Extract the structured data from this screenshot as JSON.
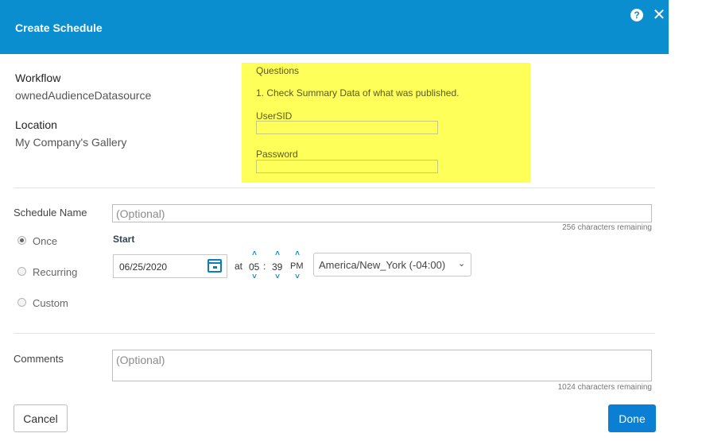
{
  "header": {
    "title": "Create Schedule",
    "help_glyph": "?",
    "close_glyph": "✕",
    "background_color": "#0a8ecf"
  },
  "info": {
    "workflow_label": "Workflow",
    "workflow_value": "ownedAudienceDatasource",
    "location_label": "Location",
    "location_value": "My Company's Gallery"
  },
  "questions": {
    "title": "Questions",
    "instruction": "1. Check Summary Data of what was published.",
    "usersid_label": "UserSID",
    "usersid_value": "",
    "password_label": "Password",
    "password_value": "",
    "highlight_color": "#ffff5a"
  },
  "schedule": {
    "name_label": "Schedule Name",
    "name_placeholder": "(Optional)",
    "name_value": "",
    "name_hint": "256 characters remaining",
    "frequency_options": [
      {
        "label": "Once",
        "selected": true
      },
      {
        "label": "Recurring",
        "selected": false
      },
      {
        "label": "Custom",
        "selected": false
      }
    ],
    "start_label": "Start",
    "date_value": "06/25/2020",
    "at_label": "at",
    "hour": "05",
    "time_separator": ":",
    "minute": "39",
    "meridiem": "PM",
    "up_glyph": "˄",
    "down_glyph": "˅",
    "timezone": "America/New_York (-04:00)",
    "timezone_chevron": "⌄"
  },
  "comments": {
    "label": "Comments",
    "placeholder": "(Optional)",
    "value": "",
    "hint": "1024 characters remaining"
  },
  "footer": {
    "cancel_label": "Cancel",
    "done_label": "Done",
    "done_color": "#0a7fd4"
  }
}
